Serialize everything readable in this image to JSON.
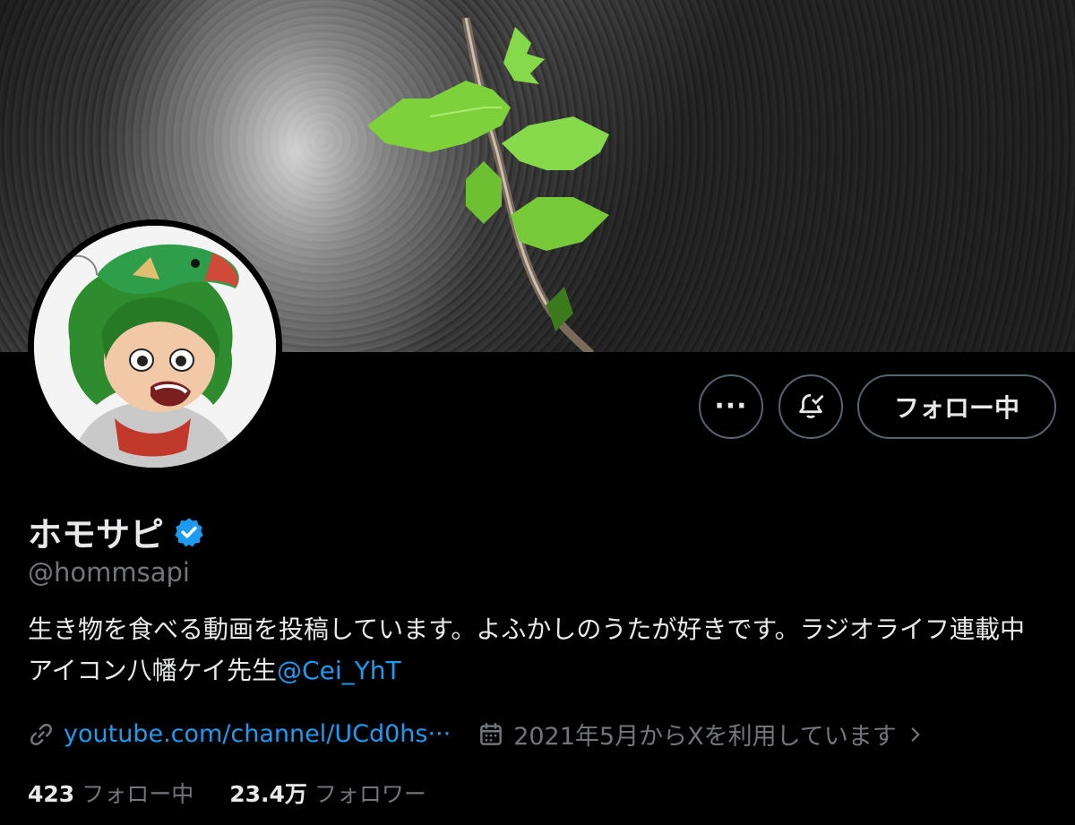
{
  "profile": {
    "display_name": "ホモサピ",
    "handle": "@hommsapi",
    "verified": true,
    "bio_text": "生き物を食べる動画を投稿しています。よふかしのうたが好きです。ラジオライフ連載中　　アイコン八幡ケイ先生",
    "bio_mention": "@Cei_YhT",
    "link": "youtube.com/channel/UCd0hs···",
    "joined": "2021年5月からXを利用しています"
  },
  "actions": {
    "more_label": "···",
    "follow_label": "フォロー中"
  },
  "stats": {
    "following_count": "423",
    "following_label": "フォロー中",
    "followers_count": "23.4万",
    "followers_label": "フォロワー"
  },
  "icons": {
    "more": "more-dots-icon",
    "notify": "bell-check-icon",
    "verified": "verified-badge-icon",
    "link": "link-icon",
    "calendar": "calendar-icon",
    "chevron": "chevron-right-icon"
  },
  "colors": {
    "background": "#000000",
    "accent": "#1d9bf0",
    "secondary_text": "#71767b",
    "primary_text": "#e7e9ea"
  }
}
